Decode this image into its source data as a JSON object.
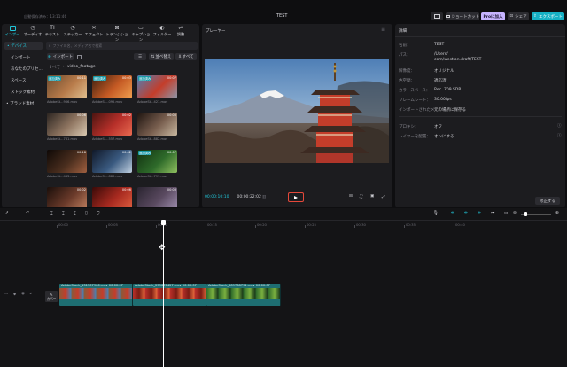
{
  "titlebar": {
    "autosave": "自動保存済み：13:11:46",
    "project_title": "TEST",
    "shortcut_label": "ショートカット",
    "pro_label": "Proに加入",
    "share_label": "シェア",
    "export_label": "エクスポート"
  },
  "toolbar_tabs": [
    {
      "label": "インポート"
    },
    {
      "label": "オーディオ"
    },
    {
      "label": "テキスト"
    },
    {
      "label": "ステッカー"
    },
    {
      "label": "エフェクト"
    },
    {
      "label": "トランジション"
    },
    {
      "label": "キャプション"
    },
    {
      "label": "フィルター"
    },
    {
      "label": "調整"
    }
  ],
  "media": {
    "sidebar": [
      {
        "label": "• デバイス"
      },
      {
        "label": "インポート"
      },
      {
        "label": "あなたのプリセ..."
      },
      {
        "label": "スペース"
      },
      {
        "label": "ストック素材"
      },
      {
        "label": "• ブランド素材"
      }
    ],
    "search_placeholder": "ファイル名、メディア名で検索",
    "import_label": "インポート",
    "sort_label": "並べ替え",
    "all_label": "すべて",
    "breadcrumb_all": "すべて",
    "breadcrumb_folder": "video_footage",
    "clips": [
      {
        "name": "AdobeSt...966.mov",
        "duration": "00:11",
        "added": true
      },
      {
        "name": "AdobeSt...095.mov",
        "duration": "00:03",
        "added": true
      },
      {
        "name": "AdobeSt...427.mov",
        "duration": "00:07",
        "added": true
      },
      {
        "name": "AdobeSt...781.mov",
        "duration": "00:06",
        "added": false
      },
      {
        "name": "AdobeSt...557.mov",
        "duration": "00:02",
        "added": false
      },
      {
        "name": "AdobeSt...882.mov",
        "duration": "00:05",
        "added": false
      },
      {
        "name": "AdobeSt...443.mov",
        "duration": "00:18",
        "added": false
      },
      {
        "name": "AdobeSt...880.mov",
        "duration": "00:02",
        "added": false
      },
      {
        "name": "AdobeSt...791.mov",
        "duration": "00:07",
        "added": true
      },
      {
        "name": "AdobeSt...102.mov",
        "duration": "00:02",
        "added": false
      },
      {
        "name": "AdobeSt...553.mov",
        "duration": "00:06",
        "added": false
      },
      {
        "name": "AdobeSt...218.mov",
        "duration": "00:03",
        "added": false
      }
    ],
    "added_badge": "追加済み"
  },
  "player": {
    "title": "プレーヤー",
    "current_time": "00:00:10:10",
    "total_time": "00:00:22:02"
  },
  "details": {
    "title": "詳細",
    "rows": [
      {
        "key": "名前：",
        "value": "TEST"
      },
      {
        "key": "パス：",
        "value": "/Users/\ncom/westion.draft/TEST"
      },
      {
        "key": "解像度：",
        "value": "オリジナル"
      },
      {
        "key": "色空間：",
        "value": "適応済"
      },
      {
        "key": "カラースペース：",
        "value": "Rec. 709 SDR"
      },
      {
        "key": "フレームレート：",
        "value": "30.00fps"
      },
      {
        "key": "インポートされたメ...",
        "value": "元の場所に保存る"
      },
      {
        "key": "プロキシ：",
        "value": "オフ"
      },
      {
        "key": "レイヤーを配置：",
        "value": "オンにする"
      }
    ],
    "edit_button": "修正する"
  },
  "timeline": {
    "ruler": [
      "00:00",
      "00:05",
      "00:10",
      "00:15",
      "00:20",
      "00:25",
      "00:30",
      "00:35",
      "00:40"
    ],
    "cover_label": "カバー",
    "clips": [
      {
        "label": "AdobeStock_131507966.mov  00:00:07"
      },
      {
        "label": "AdobeStock_259076427.mov  00:00:07"
      },
      {
        "label": "AdobeStock_589738791.mov  00:00:07"
      }
    ]
  },
  "colors": {
    "accent": "#21c5d8",
    "added_badge": "#1a9aa8",
    "clip_track": "#1e6e72",
    "pro_badge": "#c6b3ff",
    "export_button": "#16b0c4",
    "playhead": "#ffffff"
  }
}
